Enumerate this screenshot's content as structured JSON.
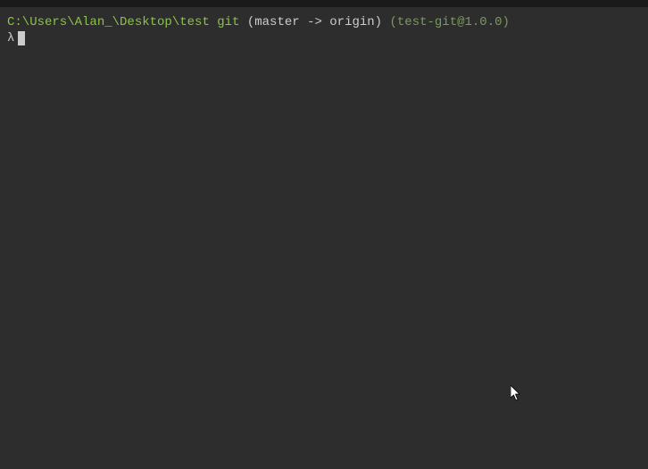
{
  "prompt": {
    "path": "C:\\Users\\Alan_\\Desktop\\test git",
    "branch_info": " (master -> origin) ",
    "package_info": "(test-git@1.0.0)",
    "lambda": "λ"
  }
}
